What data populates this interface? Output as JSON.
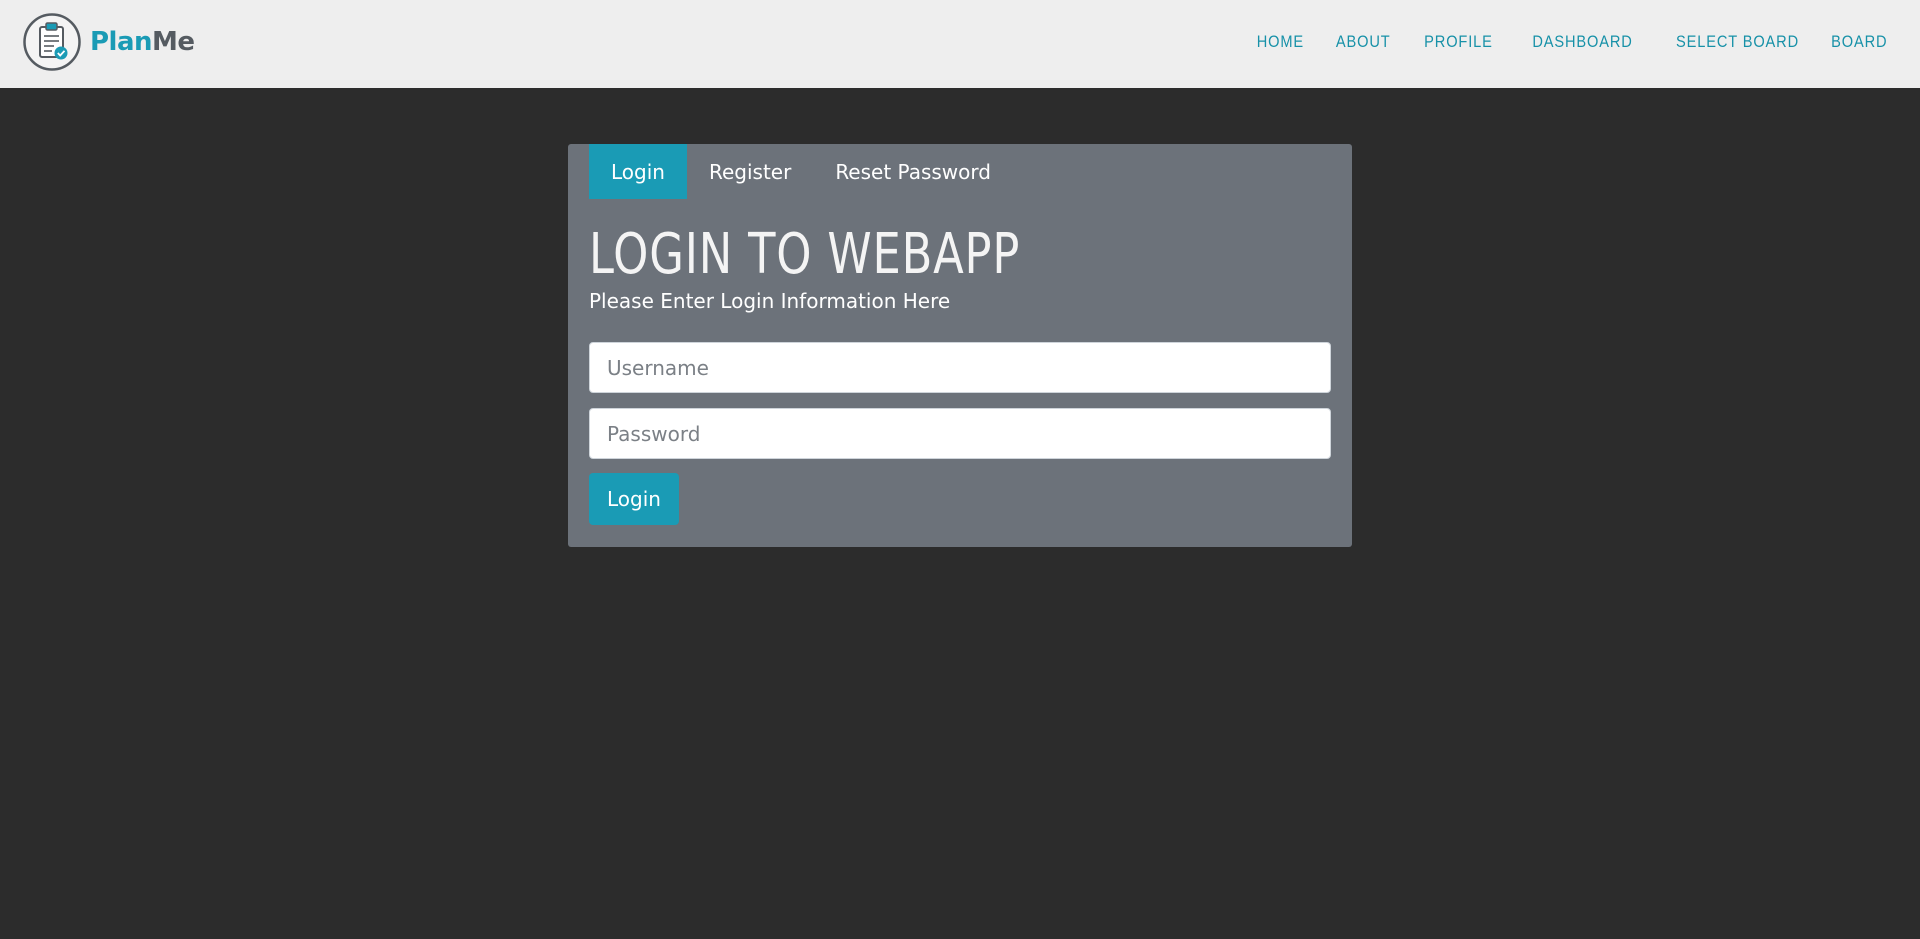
{
  "brand": {
    "name_part1": "Plan",
    "name_part2": "Me",
    "logo_icon": "clipboard-check-icon",
    "accent_color": "#1a9bb5"
  },
  "nav": {
    "items": [
      {
        "label": "HOME"
      },
      {
        "label": "ABOUT"
      },
      {
        "label": "PROFILE"
      },
      {
        "label": "DASHBOARD"
      },
      {
        "label": "SELECT BOARD"
      },
      {
        "label": "BOARD"
      }
    ]
  },
  "tabs": [
    {
      "label": "Login",
      "active": true
    },
    {
      "label": "Register",
      "active": false
    },
    {
      "label": "Reset Password",
      "active": false
    }
  ],
  "form": {
    "title": "LOGIN TO WEBAPP",
    "subtitle": "Please Enter Login Information Here",
    "username": {
      "placeholder": "Username",
      "value": ""
    },
    "password": {
      "placeholder": "Password",
      "value": ""
    },
    "submit_label": "Login"
  },
  "colors": {
    "page_background": "#2c2c2c",
    "navbar_background": "#eeeeee",
    "card_background": "#6c727a",
    "primary": "#1a9bb5"
  }
}
